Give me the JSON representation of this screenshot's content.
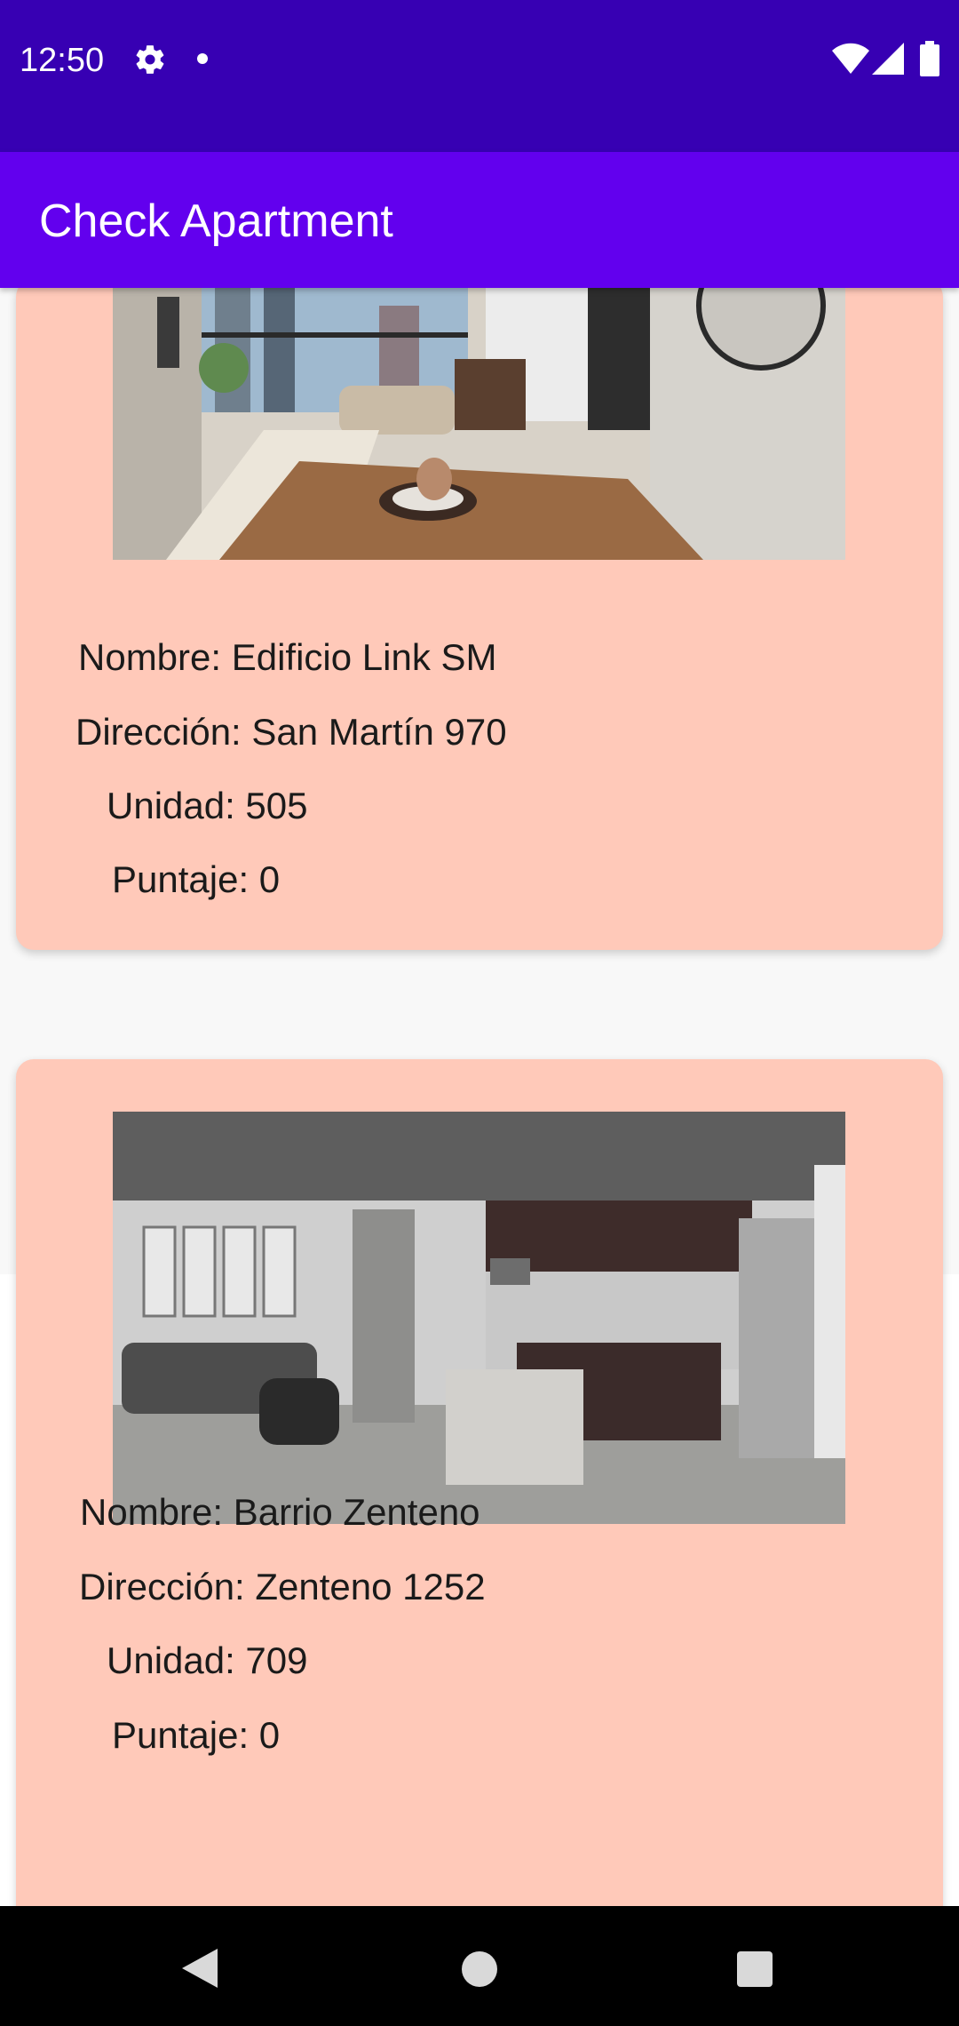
{
  "status_bar": {
    "time": "12:50",
    "icons": [
      "gear-icon",
      "notification-dot-icon",
      "wifi-icon",
      "cell-signal-icon",
      "battery-icon"
    ],
    "color": "#3700b3"
  },
  "app_bar": {
    "title": "Check Apartment",
    "color": "#6200ee"
  },
  "card_color": "#ffc9b9",
  "apartments": [
    {
      "nombre": "Nombre: Edificio Link SM",
      "direccion": "Dirección: San Martín 970",
      "unidad": "Unidad: 505",
      "puntaje": "Puntaje: 0"
    },
    {
      "nombre": "Nombre: Barrio Zenteno",
      "direccion": "Dirección: Zenteno 1252",
      "unidad": "Unidad: 709",
      "puntaje": "Puntaje: 0"
    }
  ],
  "nav_bar": {
    "icons": [
      "back-icon",
      "home-icon",
      "recents-icon"
    ]
  }
}
